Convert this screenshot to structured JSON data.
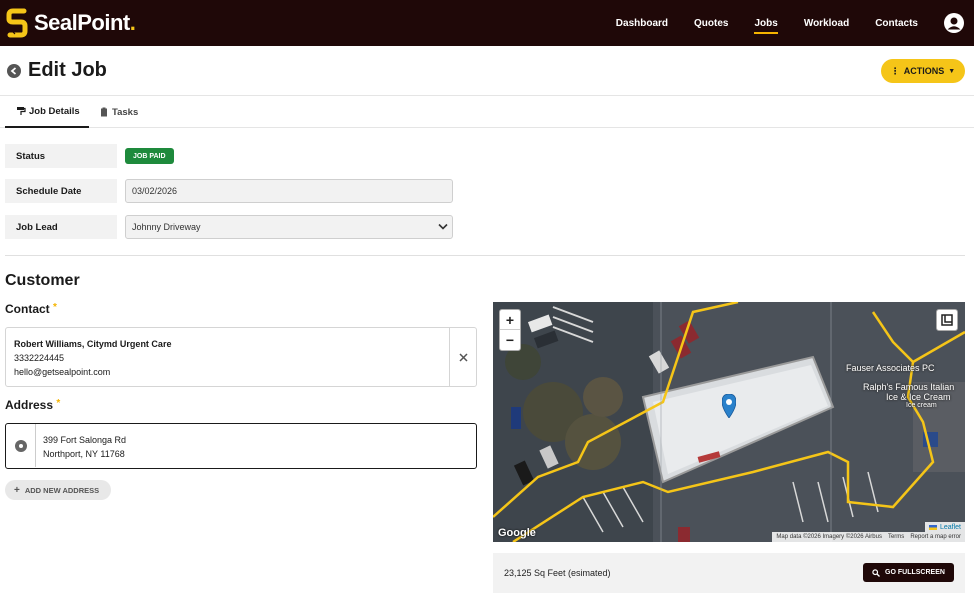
{
  "app": {
    "brand": "SealPoint",
    "brand_suffix": ".",
    "nav": [
      "Dashboard",
      "Quotes",
      "Jobs",
      "Workload",
      "Contacts"
    ],
    "active_nav": "Jobs"
  },
  "header": {
    "title": "Edit Job",
    "actions_label": "ACTIONS"
  },
  "tabs": [
    {
      "label": "Job Details",
      "active": true
    },
    {
      "label": "Tasks",
      "active": false
    }
  ],
  "job": {
    "status_label": "Status",
    "status_value": "JOB PAID",
    "schedule_label": "Schedule Date",
    "schedule_value": "03/02/2026",
    "lead_label": "Job Lead",
    "lead_value": "Johnny Driveway"
  },
  "customer": {
    "section_title": "Customer",
    "contact_label": "Contact",
    "contact_name": "Robert Williams, Citymd Urgent Care",
    "contact_phone": "3332224445",
    "contact_email": "hello@getsealpoint.com",
    "address_label": "Address",
    "address_line1": "399 Fort Salonga Rd",
    "address_line2": "Northport, NY 11768",
    "add_address_label": "ADD NEW ADDRESS",
    "required_mark": "*"
  },
  "map": {
    "poi_1": "Fauser Associates PC",
    "poi_2_line1": "Ralph's Famous Italian",
    "poi_2_line2": "Ice & Ice Cream",
    "poi_2_line3": "Ice cream",
    "google_label": "Google",
    "leaflet_label": "Leaflet",
    "attribution": "Map data ©2026 Imagery ©2026 Airbus",
    "terms": "Terms",
    "report": "Report a map error",
    "zoom_in": "+",
    "zoom_out": "−",
    "area_text": "23,125 Sq Feet (esimated)",
    "fullscreen_label": "GO FULLSCREEN"
  },
  "colors": {
    "nav_bg": "#1f0808",
    "accent": "#f5c518",
    "status_green": "#1e8a3c"
  }
}
